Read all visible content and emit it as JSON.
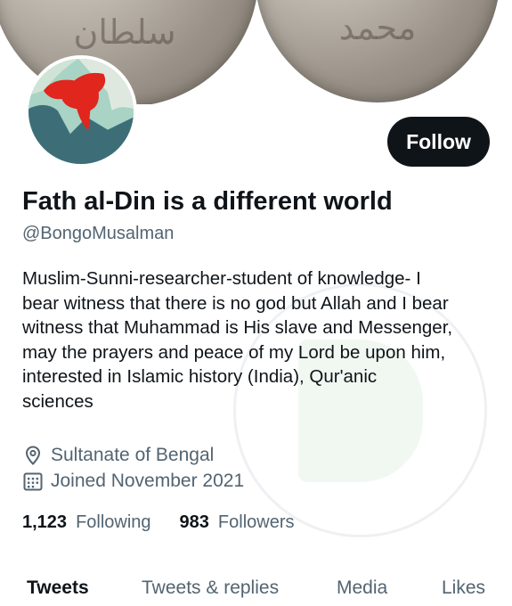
{
  "banner": {
    "coin_left_text": "سلطان",
    "coin_right_text": "محمد"
  },
  "avatar": {
    "alt": "profile avatar"
  },
  "follow_button": {
    "label": "Follow"
  },
  "profile": {
    "display_name": "Fath al-Din is a different world",
    "handle": "@BongoMusalman",
    "bio_lines": [
      "Muslim-Sunni-researcher-student of knowledge- I",
      "bear witness that there is no god but Allah and I bear",
      "witness that Muhammad is His slave and Messenger,",
      "may the prayers and peace of my Lord be upon him,",
      "interested in Islamic history (India), Qur'anic",
      "sciences"
    ],
    "location": "Sultanate of Bengal",
    "joined": "Joined November 2021"
  },
  "icons": {
    "location": "location-pin-icon",
    "joined": "calendar-icon"
  },
  "stats": {
    "following_count": "1,123",
    "following_label": "Following",
    "followers_count": "983",
    "followers_label": "Followers"
  },
  "tabs": [
    {
      "label": "Tweets",
      "active": true
    },
    {
      "label": "Tweets & replies",
      "active": false
    },
    {
      "label": "Media",
      "active": false
    },
    {
      "label": "Likes",
      "active": false
    }
  ],
  "colors": {
    "text_primary": "#0f1419",
    "text_secondary": "#536471",
    "button_bg": "#0f1419",
    "button_text": "#ffffff"
  }
}
